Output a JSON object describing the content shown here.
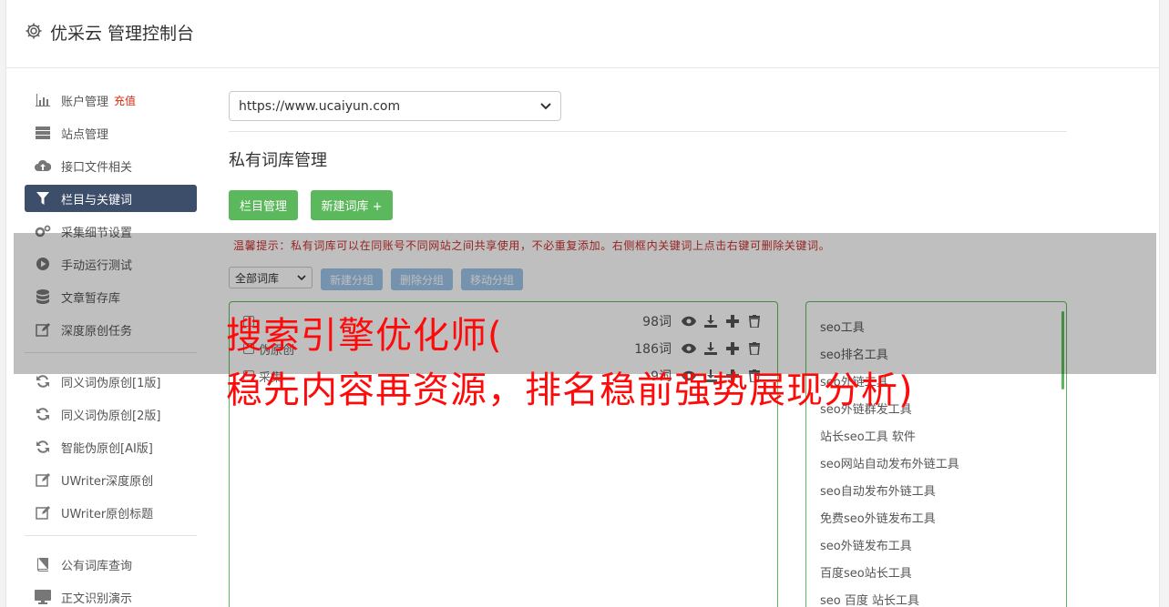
{
  "header": {
    "title": "优采云 管理控制台",
    "icon": "gear-icon"
  },
  "sidebar": {
    "items": [
      {
        "label": "账户管理",
        "badge": "充值",
        "icon": "bar-chart-icon"
      },
      {
        "label": "站点管理",
        "icon": "server-icon"
      },
      {
        "label": "接口文件相关",
        "icon": "cloud-upload-icon"
      },
      {
        "label": "栏目与关键词",
        "icon": "filter-icon",
        "active": true
      },
      {
        "label": "采集细节设置",
        "icon": "cogs-icon"
      },
      {
        "label": "手动运行测试",
        "icon": "play-circle-icon"
      },
      {
        "label": "文章暂存库",
        "icon": "database-icon"
      },
      {
        "label": "深度原创任务",
        "icon": "edit-icon"
      }
    ],
    "items2": [
      {
        "label": "同义词伪原创[1版]",
        "icon": "refresh-icon"
      },
      {
        "label": "同义词伪原创[2版]",
        "icon": "refresh-icon"
      },
      {
        "label": "智能伪原创[AI版]",
        "icon": "refresh-icon"
      },
      {
        "label": "UWriter深度原创",
        "icon": "edit-icon"
      },
      {
        "label": "UWriter原创标题",
        "icon": "edit-icon"
      }
    ],
    "items3": [
      {
        "label": "公有词库查询",
        "icon": "book-icon"
      },
      {
        "label": "正文识别演示",
        "icon": "desktop-icon"
      }
    ]
  },
  "main": {
    "site_select": "https://www.ucaiyun.com",
    "section_title": "私有词库管理",
    "btn_column": "栏目管理",
    "btn_new_lib": "新建词库 +",
    "tip": "温馨提示：私有词库可以在同账号不同网站之间共享使用，不必重复添加。右侧框内关键词上点击右键可删除关键词。",
    "lib_select": "全部词库",
    "btn_new_group": "新建分组",
    "btn_delete_group": "删除分组",
    "btn_move_group": "移动分组",
    "libraries": [
      {
        "name": "",
        "count": "98词"
      },
      {
        "name": "伪原创",
        "count": "186词"
      },
      {
        "name": "采集",
        "count": "9词"
      }
    ],
    "keywords": [
      "seo工具",
      "seo排名工具",
      "seo外链工具",
      "seo外链群发工具",
      "站长seo工具 软件",
      "seo网站自动发布外链工具",
      "seo自动发布外链工具",
      "免费seo外链发布工具",
      "seo外链发布工具",
      "百度seo站长工具",
      "seo 百度 站长工具"
    ]
  },
  "overlay": {
    "line1": "搜索引擎优化师(",
    "line2": "稳先内容再资源，排名稳前强势展现分析)"
  },
  "colors": {
    "green": "#5cb85c",
    "nav_active": "#3d4e6b",
    "overlay_text": "#ff0a0a",
    "blue_btn": "#9cc3ea"
  }
}
